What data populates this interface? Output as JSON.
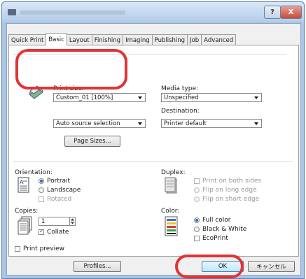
{
  "dialog": {
    "help_label": "?",
    "close_label": "X"
  },
  "tabs": [
    "Quick Print",
    "Basic",
    "Layout",
    "Finishing",
    "Imaging",
    "Publishing",
    "Job",
    "Advanced"
  ],
  "print_size": {
    "label": "Print size:",
    "value": "Custom_01 [100%]"
  },
  "paper_source": {
    "value": "Auto source selection"
  },
  "page_sizes_button": "Page Sizes...",
  "media_type": {
    "label": "Media type:",
    "value": "Unspecified"
  },
  "destination": {
    "label": "Destination:",
    "value": "Printer default"
  },
  "orientation": {
    "label": "Orientation:",
    "portrait": "Portrait",
    "landscape": "Landscape",
    "rotated": "Rotated"
  },
  "duplex": {
    "label": "Duplex:",
    "print_both_sides": "Print on both sides",
    "flip_long": "Flip on long edge",
    "flip_short": "Flip on short edge"
  },
  "copies": {
    "label": "Copies:",
    "value": "1",
    "collate": "Collate"
  },
  "color": {
    "label": "Color:",
    "full_color": "Full color",
    "black_white": "Black & White",
    "ecoprint": "EcoPrint"
  },
  "print_preview": "Print preview",
  "footer": {
    "profiles": "Profiles...",
    "ok": "OK",
    "cancel": "キャンセル"
  }
}
